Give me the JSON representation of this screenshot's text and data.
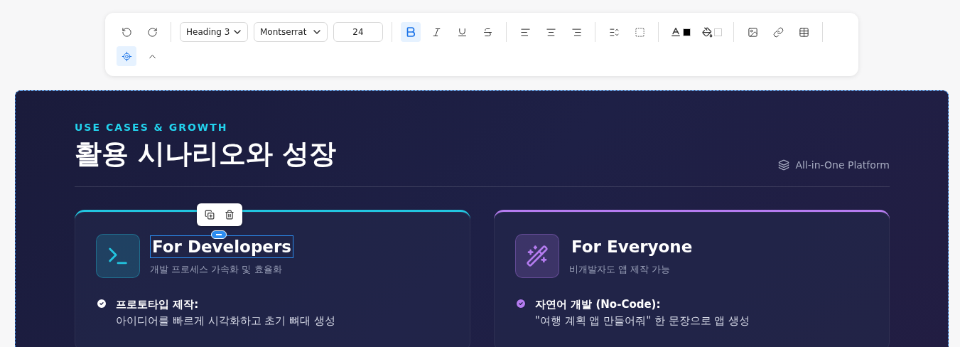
{
  "toolbar": {
    "items": [
      {
        "kind": "undo",
        "active": false
      },
      {
        "kind": "redo",
        "active": false
      },
      {
        "kind": "separator"
      },
      {
        "kind": "select",
        "value": "Heading 3"
      },
      {
        "kind": "select",
        "value": "Montserrat"
      },
      {
        "kind": "input",
        "value": "24"
      },
      {
        "kind": "separator"
      },
      {
        "kind": "bold",
        "active": true
      },
      {
        "kind": "italic",
        "active": false
      },
      {
        "kind": "underline",
        "active": false
      },
      {
        "kind": "strike",
        "active": false
      },
      {
        "kind": "separator"
      },
      {
        "kind": "align-left",
        "active": false
      },
      {
        "kind": "align-center",
        "active": false
      },
      {
        "kind": "align-right",
        "active": false
      },
      {
        "kind": "separator"
      },
      {
        "kind": "line-height",
        "active": false
      },
      {
        "kind": "padding",
        "active": false
      },
      {
        "kind": "separator"
      },
      {
        "kind": "text-color",
        "color": "#000000"
      },
      {
        "kind": "fill-color",
        "color": "#ffffff"
      },
      {
        "kind": "separator"
      },
      {
        "kind": "image",
        "active": false
      },
      {
        "kind": "link",
        "active": false
      },
      {
        "kind": "table",
        "active": false
      },
      {
        "kind": "separator"
      },
      {
        "kind": "target",
        "active": true
      },
      {
        "kind": "collapse",
        "active": false
      }
    ]
  },
  "slide": {
    "eyebrow": "USE CASES & GROWTH",
    "title": "활용 시나리오와 성장",
    "platform": "All-in-One Platform",
    "cards": [
      {
        "kind": "terminal",
        "color": "#22c5e0",
        "title": "For Developers",
        "subtitle": "개발 프로세스 가속화 및 효율화",
        "editing": true,
        "bullets": [
          {
            "title": "프로토타입 제작:",
            "text": "아이디어를 빠르게 시각화하고 초기 뼈대 생성"
          }
        ]
      },
      {
        "kind": "wand",
        "color": "#b57cf0",
        "title": "For Everyone",
        "subtitle": "비개발자도 앱 제작 가능",
        "editing": false,
        "bullets": [
          {
            "title": "자연어 개발 (No-Code):",
            "text": "\"여행 계획 앱 만들어줘\" 한 문장으로 앱 생성"
          }
        ]
      }
    ]
  }
}
